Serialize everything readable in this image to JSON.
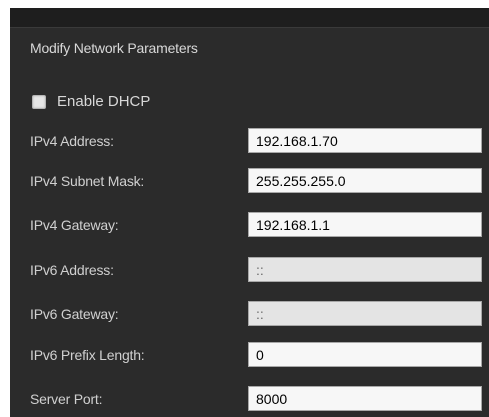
{
  "section": {
    "title": "Modify Network Parameters"
  },
  "dhcp": {
    "label": "Enable DHCP",
    "checked": false
  },
  "fields": [
    {
      "label": "IPv4 Address:",
      "value": "192.168.1.70",
      "enabled": true
    },
    {
      "label": "IPv4 Subnet Mask:",
      "value": "255.255.255.0",
      "enabled": true
    },
    {
      "label": "IPv4 Gateway:",
      "value": "192.168.1.1",
      "enabled": true
    },
    {
      "label": "IPv6 Address:",
      "value": "::",
      "enabled": false
    },
    {
      "label": "IPv6 Gateway:",
      "value": "::",
      "enabled": false
    },
    {
      "label": "IPv6 Prefix Length:",
      "value": "0",
      "enabled": true
    },
    {
      "label": "Server Port:",
      "value": "8000",
      "enabled": true
    }
  ]
}
